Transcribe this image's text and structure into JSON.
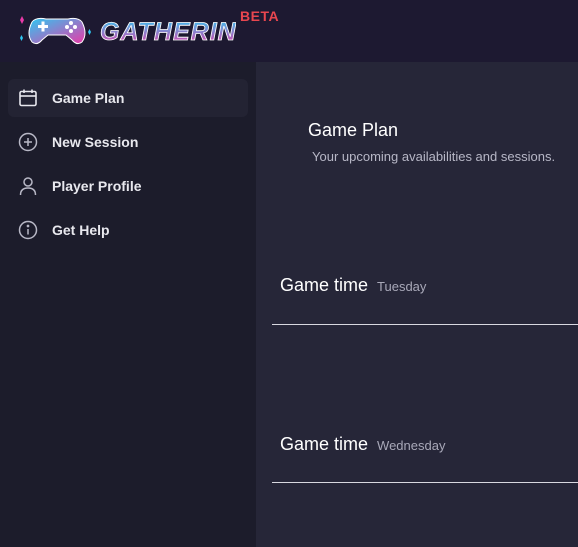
{
  "header": {
    "logo_text": "GATHERIN",
    "beta_label": "BETA"
  },
  "sidebar": {
    "items": [
      {
        "label": "Game Plan",
        "icon": "calendar-icon",
        "active": true
      },
      {
        "label": "New Session",
        "icon": "plus-circle-icon",
        "active": false
      },
      {
        "label": "Player Profile",
        "icon": "user-icon",
        "active": false
      },
      {
        "label": "Get Help",
        "icon": "info-circle-icon",
        "active": false
      }
    ]
  },
  "main": {
    "title": "Game Plan",
    "subtitle": "Your upcoming availabilities and sessions.",
    "sessions": [
      {
        "title": "Game time",
        "day": "Tuesday"
      },
      {
        "title": "Game time",
        "day": "Wednesday"
      }
    ]
  },
  "colors": {
    "header_bg": "#1d1931",
    "sidebar_bg": "#1c1c2b",
    "main_bg": "#262638",
    "beta": "#e8464f",
    "logo_gradient_start": "#2ec8f2",
    "logo_gradient_end": "#e83aa8"
  }
}
